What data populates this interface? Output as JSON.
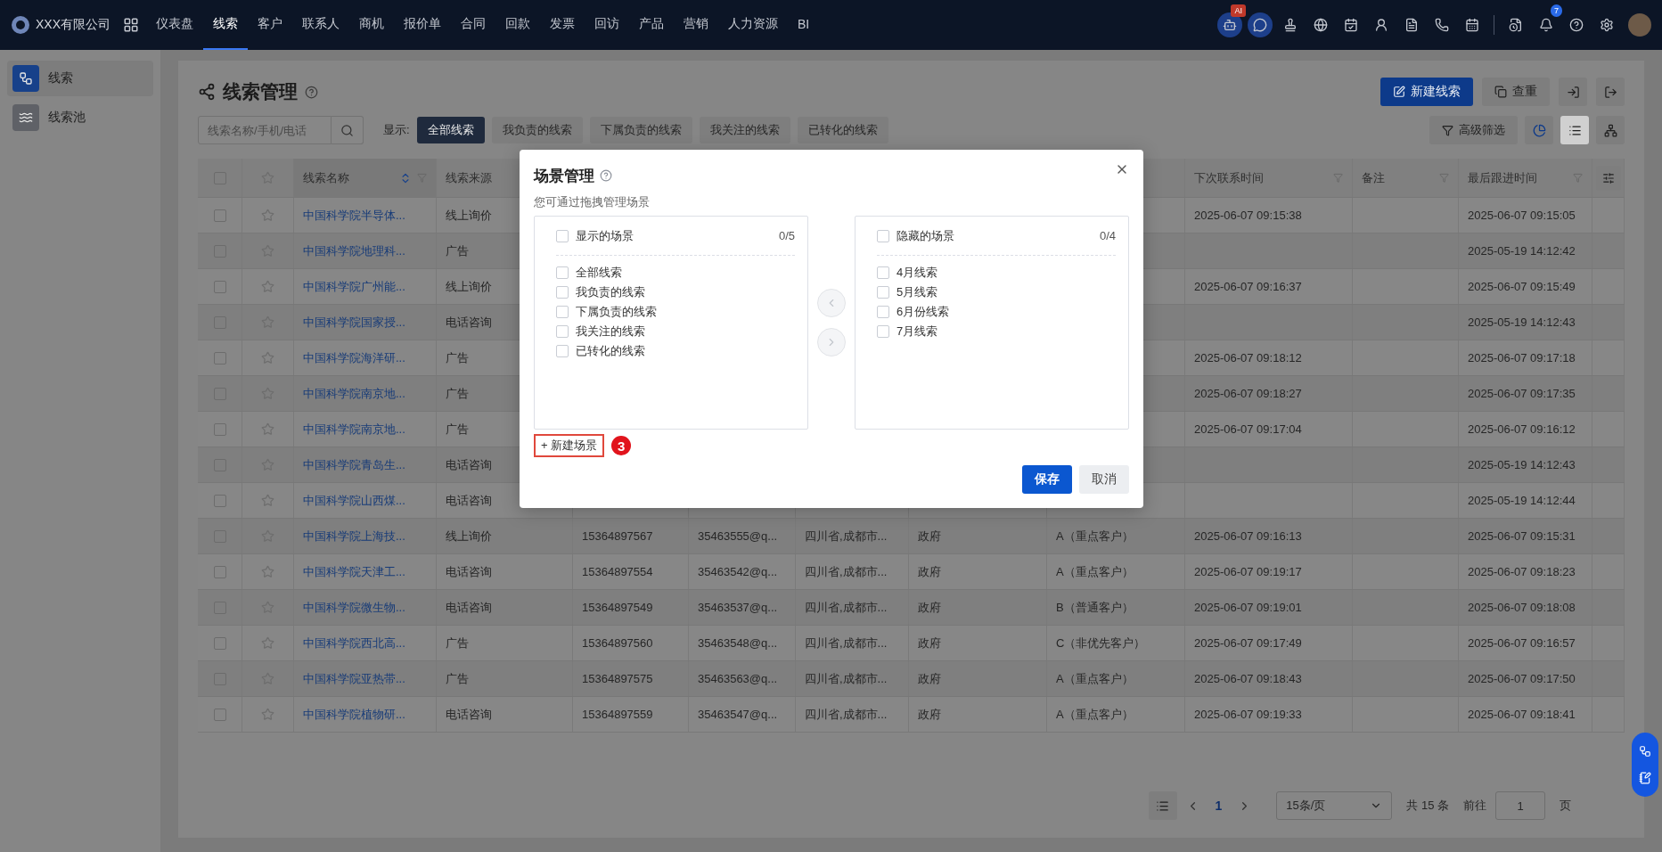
{
  "top_nav": {
    "company": "XXX有限公司",
    "items": [
      {
        "label": "仪表盘",
        "selected": false
      },
      {
        "label": "线索",
        "selected": true
      },
      {
        "label": "客户",
        "selected": false
      },
      {
        "label": "联系人",
        "selected": false
      },
      {
        "label": "商机",
        "selected": false
      },
      {
        "label": "报价单",
        "selected": false
      },
      {
        "label": "合同",
        "selected": false
      },
      {
        "label": "回款",
        "selected": false
      },
      {
        "label": "发票",
        "selected": false
      },
      {
        "label": "回访",
        "selected": false
      },
      {
        "label": "产品",
        "selected": false
      },
      {
        "label": "营销",
        "selected": false
      },
      {
        "label": "人力资源",
        "selected": false
      },
      {
        "label": "BI",
        "selected": false
      }
    ],
    "ai_badge": "AI",
    "notification_count": "7"
  },
  "sidebar": {
    "items": [
      {
        "label": "线索",
        "selected": true
      },
      {
        "label": "线索池",
        "selected": false
      }
    ]
  },
  "page": {
    "title": "线索管理",
    "buttons": [
      {
        "label": "新建线索",
        "kind": "primary"
      },
      {
        "label": "查重",
        "kind": "default"
      }
    ]
  },
  "toolbar": {
    "search": {
      "placeholder": "线索名称/手机/电话"
    },
    "filter_label": "显示:",
    "tabs": [
      {
        "label": "全部线索",
        "selected": true
      },
      {
        "label": "我负责的线索",
        "selected": false
      },
      {
        "label": "下属负责的线索",
        "selected": false
      },
      {
        "label": "我关注的线索",
        "selected": false
      },
      {
        "label": "已转化的线索",
        "selected": false
      }
    ],
    "advanced_filter": "高级筛选",
    "views": [
      {
        "kind": "list",
        "selected": true
      },
      {
        "kind": "tree",
        "selected": false
      }
    ]
  },
  "table": {
    "all_checked": false,
    "columns_left": [
      "线索名称",
      "线索来源"
    ],
    "columns_right": [
      "下次联系时间",
      "备注",
      "最后跟进时间"
    ],
    "rows": [
      {
        "checked": false,
        "starred": false,
        "name": "中国科学院半导体...",
        "source": "线上询价",
        "next_contact_time": "2025-06-07 09:15:38",
        "last_follow_up_time": "2025-06-07 09:15:05"
      },
      {
        "checked": false,
        "starred": false,
        "name": "中国科学院地理科...",
        "source": "广告",
        "last_follow_up_time": "2025-05-19 14:12:42"
      },
      {
        "checked": false,
        "starred": false,
        "name": "中国科学院广州能...",
        "source": "线上询价",
        "next_contact_time": "2025-06-07 09:16:37",
        "last_follow_up_time": "2025-06-07 09:15:49"
      },
      {
        "checked": false,
        "starred": false,
        "name": "中国科学院国家授...",
        "source": "电话咨询",
        "last_follow_up_time": "2025-05-19 14:12:43"
      },
      {
        "checked": false,
        "starred": false,
        "name": "中国科学院海洋研...",
        "source": "广告",
        "next_contact_time": "2025-06-07 09:18:12",
        "last_follow_up_time": "2025-06-07 09:17:18"
      },
      {
        "checked": false,
        "starred": false,
        "name": "中国科学院南京地...",
        "source": "广告",
        "next_contact_time": "2025-06-07 09:18:27",
        "last_follow_up_time": "2025-06-07 09:17:35"
      },
      {
        "checked": false,
        "starred": false,
        "name": "中国科学院南京地...",
        "source": "广告",
        "next_contact_time": "2025-06-07 09:17:04",
        "last_follow_up_time": "2025-06-07 09:16:12"
      },
      {
        "checked": false,
        "starred": false,
        "name": "中国科学院青岛生...",
        "source": "电话咨询",
        "last_follow_up_time": "2025-05-19 14:12:43"
      },
      {
        "checked": false,
        "starred": false,
        "name": "中国科学院山西煤...",
        "source": "电话咨询",
        "last_follow_up_time": "2025-05-19 14:12:44"
      },
      {
        "checked": false,
        "starred": false,
        "name": "中国科学院上海技...",
        "source": "线上询价",
        "column_3": "15364897567",
        "column_4": "35463555@q...",
        "column_5": "四川省,成都市...",
        "column_6": "政府",
        "column_7": "A（重点客户）",
        "next_contact_time": "2025-06-07 09:16:13",
        "last_follow_up_time": "2025-06-07 09:15:31"
      },
      {
        "checked": false,
        "starred": false,
        "name": "中国科学院天津工...",
        "source": "电话咨询",
        "column_3": "15364897554",
        "column_4": "35463542@q...",
        "column_5": "四川省,成都市...",
        "column_6": "政府",
        "column_7": "A（重点客户）",
        "next_contact_time": "2025-06-07 09:19:17",
        "last_follow_up_time": "2025-06-07 09:18:23"
      },
      {
        "checked": false,
        "starred": false,
        "name": "中国科学院微生物...",
        "source": "电话咨询",
        "column_3": "15364897549",
        "column_4": "35463537@q...",
        "column_5": "四川省,成都市...",
        "column_6": "政府",
        "column_7": "B（普通客户）",
        "next_contact_time": "2025-06-07 09:19:01",
        "last_follow_up_time": "2025-06-07 09:18:08"
      },
      {
        "checked": false,
        "starred": false,
        "name": "中国科学院西北高...",
        "source": "广告",
        "column_3": "15364897560",
        "column_4": "35463548@q...",
        "column_5": "四川省,成都市...",
        "column_6": "政府",
        "column_7": "C（非优先客户）",
        "next_contact_time": "2025-06-07 09:17:49",
        "last_follow_up_time": "2025-06-07 09:16:57"
      },
      {
        "checked": false,
        "starred": false,
        "name": "中国科学院亚热带...",
        "source": "广告",
        "column_3": "15364897575",
        "column_4": "35463563@q...",
        "column_5": "四川省,成都市...",
        "column_6": "政府",
        "column_7": "A（重点客户）",
        "next_contact_time": "2025-06-07 09:18:43",
        "last_follow_up_time": "2025-06-07 09:17:50"
      },
      {
        "checked": false,
        "starred": false,
        "name": "中国科学院植物研...",
        "source": "电话咨询",
        "column_3": "15364897559",
        "column_4": "35463547@q...",
        "column_5": "四川省,成都市...",
        "column_6": "政府",
        "column_7": "A（重点客户）",
        "next_contact_time": "2025-06-07 09:19:33",
        "last_follow_up_time": "2025-06-07 09:18:41"
      }
    ]
  },
  "pagination": {
    "pages": [
      {
        "label": "1",
        "selected": true
      }
    ],
    "page_size": "15条/页",
    "total": "共 15 条",
    "goto_label": "前往",
    "goto_value": "1",
    "page_suffix": "页"
  },
  "dialog": {
    "title": "场景管理",
    "hint": "您可通过拖拽管理场景",
    "panels": [
      {
        "title": "显示的场景",
        "count": "0/5",
        "checked": false,
        "items": [
          {
            "label": "全部线索",
            "checked": false
          },
          {
            "label": "我负责的线索",
            "checked": false
          },
          {
            "label": "下属负责的线索",
            "checked": false
          },
          {
            "label": "我关注的线索",
            "checked": false
          },
          {
            "label": "已转化的线索",
            "checked": false
          }
        ]
      },
      {
        "title": "隐藏的场景",
        "count": "0/4",
        "checked": false,
        "items": [
          {
            "label": "4月线索",
            "checked": false
          },
          {
            "label": "5月线索",
            "checked": false
          },
          {
            "label": "6月份线索",
            "checked": false
          },
          {
            "label": "7月线索",
            "checked": false
          }
        ]
      }
    ],
    "new_button": {
      "label": "+ 新建场景",
      "highlighted": true,
      "annotation": "3"
    },
    "buttons": [
      {
        "label": "保存",
        "kind": "primary"
      },
      {
        "label": "取消",
        "kind": "default"
      }
    ]
  }
}
